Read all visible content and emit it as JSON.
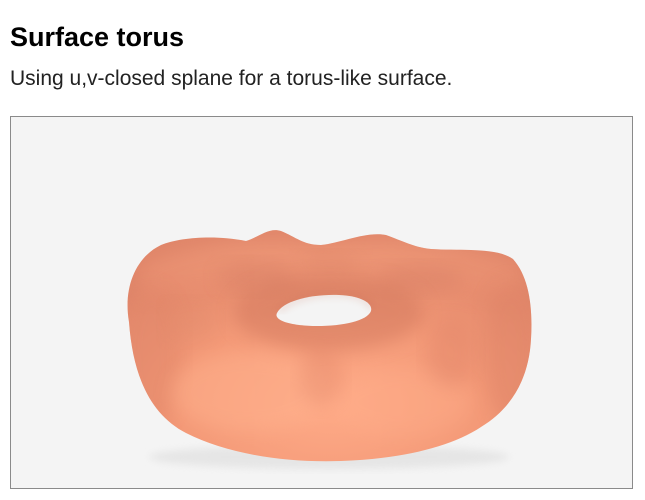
{
  "header": {
    "title": "Surface torus",
    "subtitle": "Using u,v-closed splane for a torus-like surface."
  },
  "viewer": {
    "background_color": "#f4f4f4",
    "surface_color": "#f49a78",
    "surface_shadow_color": "#c9705a",
    "surface_highlight_color": "#ffb090"
  }
}
